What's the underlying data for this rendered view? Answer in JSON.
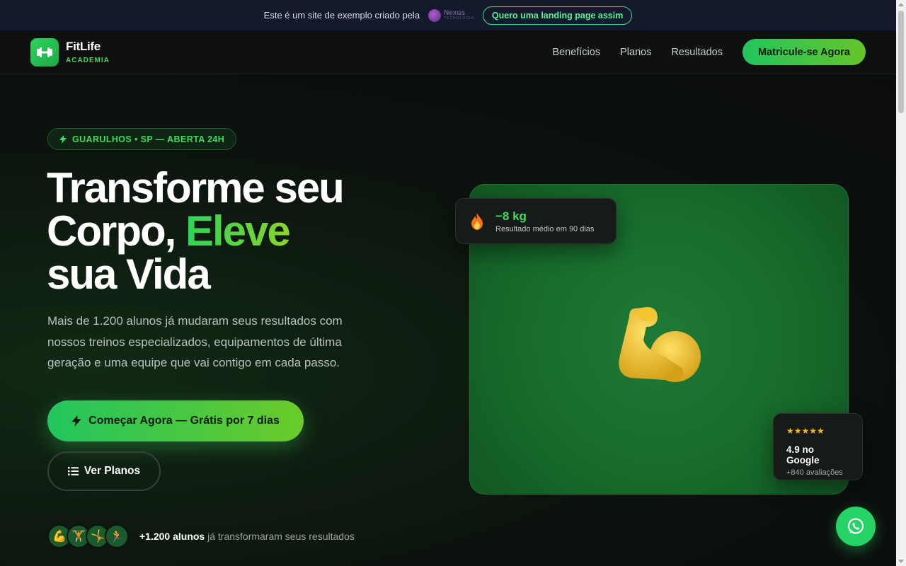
{
  "promo": {
    "text": "Este é um site de exemplo criado pela",
    "brand_name": "Nexus",
    "brand_sub": "TECNOLOGIA",
    "button": "Quero uma landing page assim"
  },
  "nav": {
    "logo_name": "FitLife",
    "logo_sub": "ACADEMIA",
    "links": [
      "Benefícios",
      "Planos",
      "Resultados"
    ],
    "cta": "Matricule-se Agora"
  },
  "hero": {
    "badge": "GUARULHOS • SP — ABERTA 24H",
    "title_line1": "Transforme seu",
    "title_line2_a": "Corpo,",
    "title_line2_accent": "Eleve",
    "title_line3": "sua Vida",
    "lead": "Mais de 1.200 alunos já mudaram seus resultados com nossos treinos especializados, equipamentos de última geração e uma equipe que vai contigo em cada passo.",
    "cta_primary": "Começar Agora — Grátis por 7 dias",
    "cta_secondary": "Ver Planos",
    "social_avatars": [
      "💪",
      "🏋️",
      "🤸",
      "🏃"
    ],
    "social_strong": "+1.200 alunos",
    "social_rest": "já transformaram seus resultados"
  },
  "visual": {
    "stat_value": "−8 kg",
    "stat_label": "Resultado médio em 90 dias",
    "rating_stars": "★★★★★",
    "rating_score": "4.9 no Google",
    "rating_count": "+840 avaliações"
  },
  "colors": {
    "accent": "#3ddc5a",
    "whatsapp": "#25d366",
    "card": "#1f7a36"
  }
}
